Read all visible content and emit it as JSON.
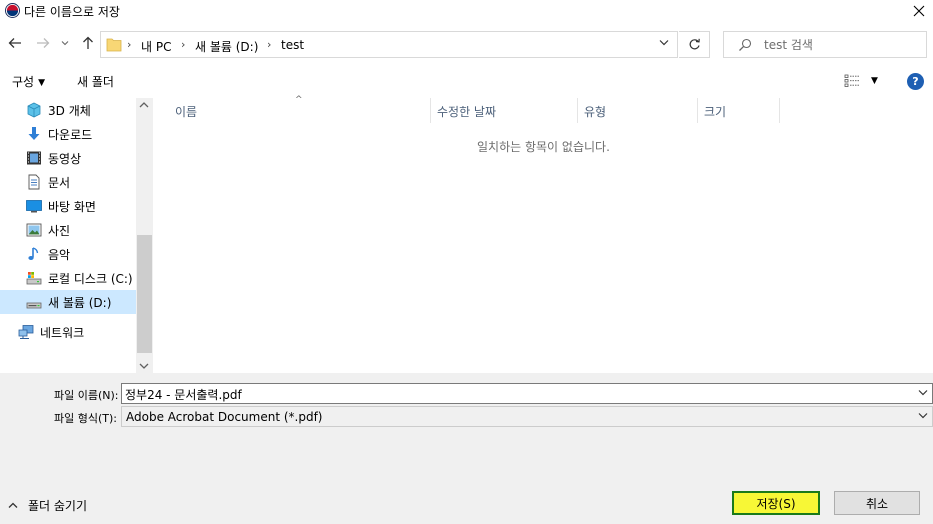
{
  "window": {
    "title": "다른 이름으로 저장"
  },
  "nav": {
    "breadcrumbs": [
      "내 PC",
      "새 볼륨 (D:)",
      "test"
    ],
    "search_placeholder": "test 검색"
  },
  "commands": {
    "organize": "구성",
    "new_folder": "새 폴더"
  },
  "sidebar": {
    "items": [
      {
        "label": "3D 개체",
        "icon": "3d-objects-icon"
      },
      {
        "label": "다운로드",
        "icon": "download-icon"
      },
      {
        "label": "동영상",
        "icon": "video-icon"
      },
      {
        "label": "문서",
        "icon": "document-icon"
      },
      {
        "label": "바탕 화면",
        "icon": "desktop-icon"
      },
      {
        "label": "사진",
        "icon": "picture-icon"
      },
      {
        "label": "음악",
        "icon": "music-icon"
      },
      {
        "label": "로컬 디스크 (C:)",
        "icon": "local-disk-icon"
      },
      {
        "label": "새 볼륨 (D:)",
        "icon": "drive-icon",
        "selected": true
      },
      {
        "label": "네트워크",
        "icon": "network-icon"
      }
    ]
  },
  "filelist": {
    "columns": [
      "이름",
      "수정한 날짜",
      "유형",
      "크기"
    ],
    "empty_message": "일치하는 항목이 없습니다."
  },
  "form": {
    "filename_label": "파일 이름(N):",
    "filename_value": "정부24 - 문서출력.pdf",
    "filetype_label": "파일 형식(T):",
    "filetype_value": "Adobe Acrobat Document (*.pdf)"
  },
  "footer": {
    "hide_folders": "폴더 숨기기",
    "save_label": "저장(S)",
    "cancel_label": "취소"
  },
  "colors": {
    "selected_bg": "#cce8ff",
    "save_highlight": "#f7f736",
    "save_border": "#1a7a1a",
    "help_blue": "#1e5fb3"
  }
}
